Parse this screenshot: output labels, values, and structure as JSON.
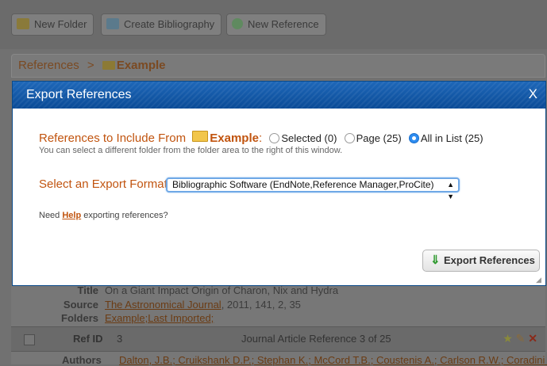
{
  "toolbar": {
    "new_folder": "New Folder",
    "create_bibliography": "Create Bibliography",
    "new_reference": "New Reference"
  },
  "breadcrumb": {
    "root": "References",
    "sep": ">",
    "folder": "Example"
  },
  "modal": {
    "title": "Export References",
    "close": "X",
    "include_label": "References to Include From",
    "include_folder": "Example",
    "include_colon": ":",
    "options": [
      "Selected (0)",
      "Page (25)",
      "All in List (25)"
    ],
    "selected_option": "All in List (25)",
    "hint": "You can select a different folder from the folder area to the right of this window.",
    "format_label": "Select an Export Format",
    "format_value": "Bibliographic Software (EndNote,Reference Manager,ProCite)",
    "need_prefix": "Need",
    "need_link": "Help",
    "need_suffix": "exporting references?",
    "export_button": "Export References"
  },
  "background_list": {
    "title_label": "Title",
    "title_value": "On a Giant Impact Origin of Charon, Nix and Hydra",
    "source_label": "Source",
    "source_link": "The Astronomical Journal",
    "source_rest": ", 2011, 141, 2, 35",
    "folders_label": "Folders",
    "folders_value": "Example;Last Imported;",
    "refid_label": "Ref ID",
    "refid_value": "3",
    "ref_type": "Journal Article Reference 3 of 25",
    "authors_label": "Authors",
    "authors_value": "Dalton, J.B.; Cruikshank D.P.; Stephan K.; McCord T.B.; Coustenis A.; Carlson R.W.; Coradini A."
  },
  "colors": {
    "accent_orange": "#c1540f",
    "header_blue": "#0b4d9a",
    "radio_blue": "#2e8cf0"
  }
}
